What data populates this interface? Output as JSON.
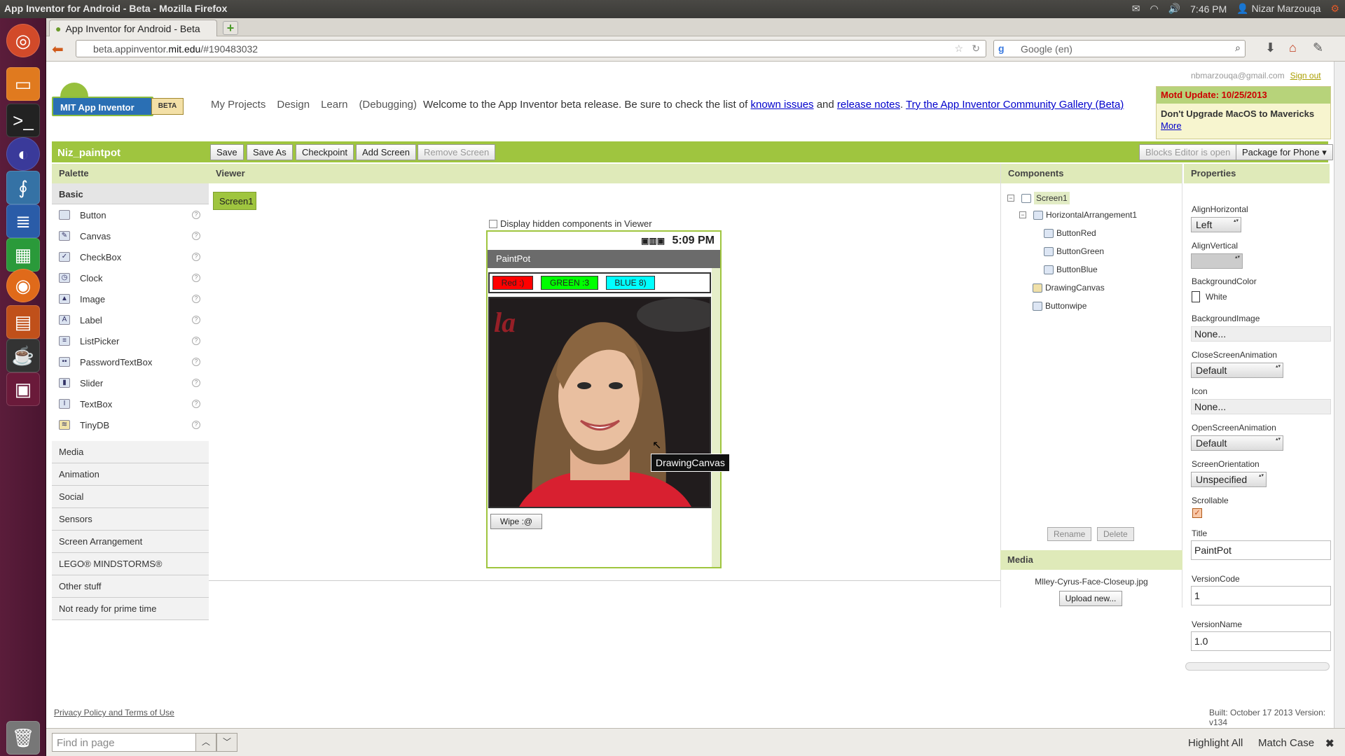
{
  "os": {
    "window_title": "App Inventor for Android - Beta - Mozilla Firefox",
    "clock": "7:46 PM",
    "user": "Nizar Marzouqa"
  },
  "browser": {
    "tab_title": "App Inventor for Android - Beta",
    "url_host_pre": "beta.appinventor.",
    "url_host_main": "mit.edu",
    "url_rest": "/#190483032",
    "search_placeholder": "Google (en)"
  },
  "header": {
    "logo_text": "MIT App Inventor",
    "beta_badge": "BETA",
    "nav": [
      "My Projects",
      "Design",
      "Learn",
      "(Debugging)"
    ],
    "welcome_text": "Welcome to the App Inventor beta release. Be sure to check the list of",
    "known_issues": "known issues",
    "and_text": "and",
    "release_notes": "release notes",
    "community_link": "Try the App Inventor Community Gallery (Beta)",
    "user_email": "nbmarzouqa@gmail.com",
    "sign_out": "Sign out"
  },
  "motd": {
    "title": "Motd Update: 10/25/2013",
    "body": "Don't Upgrade MacOS to Mavericks",
    "more": "More"
  },
  "toolbar": {
    "project_name": "Niz_paintpot",
    "save": "Save",
    "save_as": "Save As",
    "checkpoint": "Checkpoint",
    "add_screen": "Add Screen",
    "remove_screen": "Remove Screen",
    "blocks_editor": "Blocks Editor is open",
    "package": "Package for Phone ▾"
  },
  "palette": {
    "title": "Palette",
    "basic": "Basic",
    "items": [
      "Button",
      "Canvas",
      "CheckBox",
      "Clock",
      "Image",
      "Label",
      "ListPicker",
      "PasswordTextBox",
      "Slider",
      "TextBox",
      "TinyDB"
    ],
    "sections": [
      "Media",
      "Animation",
      "Social",
      "Sensors",
      "Screen Arrangement",
      "LEGO® MINDSTORMS®",
      "Other stuff",
      "Not ready for prime time"
    ]
  },
  "viewer": {
    "title": "Viewer",
    "screen_tab": "Screen1",
    "hidden_label": "Display hidden components in Viewer",
    "phone_time": "5:09 PM",
    "app_title": "PaintPot",
    "btn_red": "Red :)",
    "btn_green": "GREEN :3",
    "btn_blue": "BLUE 8)",
    "btn_wipe": "Wipe :@",
    "tooltip": "DrawingCanvas"
  },
  "components": {
    "title": "Components",
    "tree": [
      "Screen1",
      "HorizontalArrangement1",
      "ButtonRed",
      "ButtonGreen",
      "ButtonBlue",
      "DrawingCanvas",
      "Buttonwipe"
    ],
    "rename": "Rename",
    "delete": "Delete",
    "media_title": "Media",
    "media_file": "Mlley-Cyrus-Face-Closeup.jpg",
    "upload": "Upload new..."
  },
  "properties": {
    "title": "Properties",
    "align_h_label": "AlignHorizontal",
    "align_h_value": "Left",
    "align_v_label": "AlignVertical",
    "bg_color_label": "BackgroundColor",
    "bg_color_value": "White",
    "bg_image_label": "BackgroundImage",
    "bg_image_value": "None...",
    "close_anim_label": "CloseScreenAnimation",
    "close_anim_value": "Default",
    "icon_label": "Icon",
    "icon_value": "None...",
    "open_anim_label": "OpenScreenAnimation",
    "open_anim_value": "Default",
    "orientation_label": "ScreenOrientation",
    "orientation_value": "Unspecified",
    "scrollable_label": "Scrollable",
    "title_label": "Title",
    "title_value": "PaintPot",
    "version_code_label": "VersionCode",
    "version_code_value": "1",
    "version_name_label": "VersionName",
    "version_name_value": "1.0"
  },
  "footer": {
    "privacy": "Privacy Policy and Terms of Use",
    "built": "Built: October 17 2013 Version: v134"
  },
  "findbar": {
    "placeholder": "Find in page",
    "highlight_all": "Highlight All",
    "match_case": "Match Case"
  },
  "colors": {
    "accent_green": "#9fc53f",
    "red_button": "#ff0000",
    "green_button": "#00ff00",
    "blue_button": "#00ffff"
  }
}
